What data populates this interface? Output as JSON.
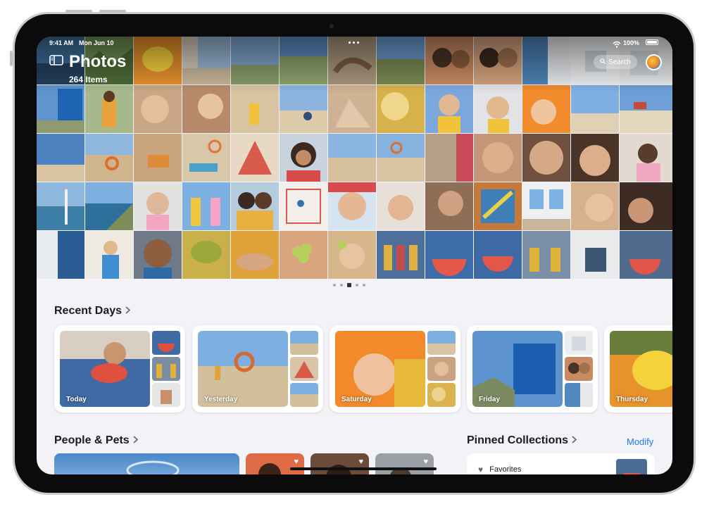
{
  "status_bar": {
    "time": "9:41 AM",
    "date": "Mon Jun 10",
    "battery": "100%"
  },
  "header": {
    "title": "Photos",
    "subtitle": "264 Items",
    "search_label": "Search"
  },
  "icons": {
    "sidebar": "sidebar-icon",
    "search": "magnifier-icon",
    "wifi": "wifi-icon",
    "battery": "battery-icon",
    "chevron": "chevron-right-icon",
    "heart": "heart-icon"
  },
  "recent_days": {
    "title": "Recent Days",
    "cards": [
      {
        "label": "Today"
      },
      {
        "label": "Yesterday"
      },
      {
        "label": "Saturday"
      },
      {
        "label": "Friday"
      },
      {
        "label": "Thursday"
      }
    ]
  },
  "people_pets": {
    "title": "People & Pets"
  },
  "pinned": {
    "title": "Pinned Collections",
    "modify_label": "Modify",
    "first_item": "Favorites"
  },
  "colors": {
    "accent": "#1a7cf0",
    "background": "#f2f2f7"
  }
}
